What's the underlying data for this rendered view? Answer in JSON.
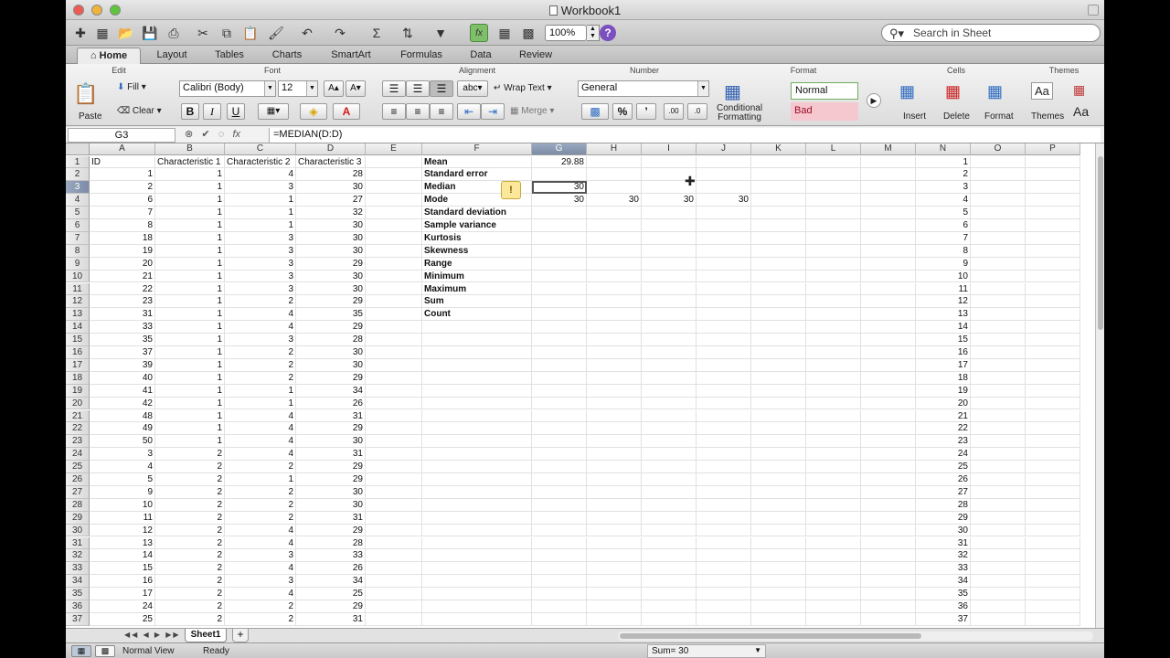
{
  "window": {
    "title": "Workbook1"
  },
  "toolbar": {
    "zoom": "100%",
    "search_placeholder": "Search in Sheet"
  },
  "tabs": [
    "Home",
    "Layout",
    "Tables",
    "Charts",
    "SmartArt",
    "Formulas",
    "Data",
    "Review"
  ],
  "ribbon": {
    "groups": [
      "Edit",
      "Font",
      "Alignment",
      "Number",
      "Format",
      "Cells",
      "Themes"
    ],
    "paste": "Paste",
    "fill": "Fill",
    "clear": "Clear",
    "font_name": "Calibri (Body)",
    "font_size": "12",
    "wrap_text": "Wrap Text",
    "merge": "Merge",
    "number_format": "General",
    "conditional_formatting": "Conditional Formatting",
    "conditional_line1": "Conditional",
    "conditional_line2": "Formatting",
    "style_normal": "Normal",
    "style_bad": "Bad",
    "insert": "Insert",
    "delete": "Delete",
    "format": "Format",
    "themes": "Themes",
    "themes_aa": "Aa",
    "bold": "B",
    "italic": "I",
    "underline": "U"
  },
  "formula_bar": {
    "name_box": "G3",
    "formula": "=MEDIAN(D:D)",
    "fx": "fx"
  },
  "columns": [
    "A",
    "B",
    "C",
    "D",
    "E",
    "F",
    "G",
    "H",
    "I",
    "J",
    "K",
    "L",
    "M",
    "N",
    "O",
    "P"
  ],
  "selected_column": "G",
  "selected_row": 3,
  "rows": [
    {
      "n": 1,
      "a": "ID",
      "b": "Characteristic 1",
      "c": "Characteristic 2",
      "d": "Characteristic 3",
      "f": "Mean",
      "g": "29.88"
    },
    {
      "n": 2,
      "a": "1",
      "b": "1",
      "c": "4",
      "d": "28",
      "f": "Standard error"
    },
    {
      "n": 3,
      "a": "2",
      "b": "1",
      "c": "3",
      "d": "30",
      "f": "Median",
      "g": "30"
    },
    {
      "n": 4,
      "a": "6",
      "b": "1",
      "c": "1",
      "d": "27",
      "f": "Mode",
      "g": "30",
      "h": "30",
      "i": "30",
      "j": "30"
    },
    {
      "n": 5,
      "a": "7",
      "b": "1",
      "c": "1",
      "d": "32",
      "f": "Standard deviation"
    },
    {
      "n": 6,
      "a": "8",
      "b": "1",
      "c": "1",
      "d": "30",
      "f": "Sample variance"
    },
    {
      "n": 7,
      "a": "18",
      "b": "1",
      "c": "3",
      "d": "30",
      "f": "Kurtosis"
    },
    {
      "n": 8,
      "a": "19",
      "b": "1",
      "c": "3",
      "d": "30",
      "f": "Skewness"
    },
    {
      "n": 9,
      "a": "20",
      "b": "1",
      "c": "3",
      "d": "29",
      "f": "Range"
    },
    {
      "n": 10,
      "a": "21",
      "b": "1",
      "c": "3",
      "d": "30",
      "f": "Minimum"
    },
    {
      "n": 11,
      "a": "22",
      "b": "1",
      "c": "3",
      "d": "30",
      "f": "Maximum"
    },
    {
      "n": 12,
      "a": "23",
      "b": "1",
      "c": "2",
      "d": "29",
      "f": "Sum"
    },
    {
      "n": 13,
      "a": "31",
      "b": "1",
      "c": "4",
      "d": "35",
      "f": "Count"
    },
    {
      "n": 14,
      "a": "33",
      "b": "1",
      "c": "4",
      "d": "29"
    },
    {
      "n": 15,
      "a": "35",
      "b": "1",
      "c": "3",
      "d": "28"
    },
    {
      "n": 16,
      "a": "37",
      "b": "1",
      "c": "2",
      "d": "30"
    },
    {
      "n": 17,
      "a": "39",
      "b": "1",
      "c": "2",
      "d": "30"
    },
    {
      "n": 18,
      "a": "40",
      "b": "1",
      "c": "2",
      "d": "29"
    },
    {
      "n": 19,
      "a": "41",
      "b": "1",
      "c": "1",
      "d": "34"
    },
    {
      "n": 20,
      "a": "42",
      "b": "1",
      "c": "1",
      "d": "26"
    },
    {
      "n": 21,
      "a": "48",
      "b": "1",
      "c": "4",
      "d": "31"
    },
    {
      "n": 22,
      "a": "49",
      "b": "1",
      "c": "4",
      "d": "29"
    },
    {
      "n": 23,
      "a": "50",
      "b": "1",
      "c": "4",
      "d": "30"
    },
    {
      "n": 24,
      "a": "3",
      "b": "2",
      "c": "4",
      "d": "31"
    },
    {
      "n": 25,
      "a": "4",
      "b": "2",
      "c": "2",
      "d": "29"
    },
    {
      "n": 26,
      "a": "5",
      "b": "2",
      "c": "1",
      "d": "29"
    },
    {
      "n": 27,
      "a": "9",
      "b": "2",
      "c": "2",
      "d": "30"
    },
    {
      "n": 28,
      "a": "10",
      "b": "2",
      "c": "2",
      "d": "30"
    },
    {
      "n": 29,
      "a": "11",
      "b": "2",
      "c": "2",
      "d": "31"
    },
    {
      "n": 30,
      "a": "12",
      "b": "2",
      "c": "4",
      "d": "29"
    },
    {
      "n": 31,
      "a": "13",
      "b": "2",
      "c": "4",
      "d": "28"
    },
    {
      "n": 32,
      "a": "14",
      "b": "2",
      "c": "3",
      "d": "33"
    },
    {
      "n": 33,
      "a": "15",
      "b": "2",
      "c": "4",
      "d": "26"
    },
    {
      "n": 34,
      "a": "16",
      "b": "2",
      "c": "3",
      "d": "34"
    },
    {
      "n": 35,
      "a": "17",
      "b": "2",
      "c": "4",
      "d": "25"
    },
    {
      "n": 36,
      "a": "24",
      "b": "2",
      "c": "2",
      "d": "29"
    },
    {
      "n": 37,
      "a": "25",
      "b": "2",
      "c": "2",
      "d": "31"
    }
  ],
  "sheets": {
    "active": "Sheet1",
    "add": "+"
  },
  "status": {
    "view": "Normal View",
    "state": "Ready",
    "sum": "Sum= 30"
  }
}
